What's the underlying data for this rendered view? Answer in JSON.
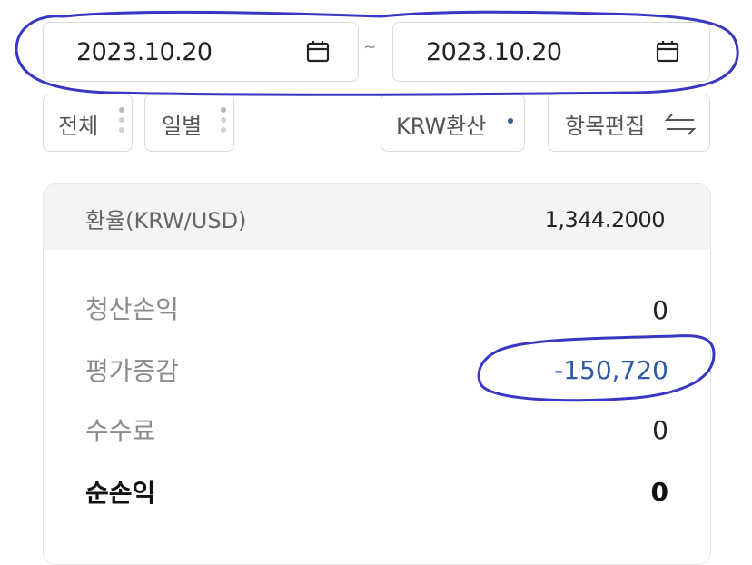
{
  "date_range": {
    "start": "2023.10.20",
    "separator": "~",
    "end": "2023.10.20"
  },
  "filters": {
    "all": "전체",
    "daily": "일별",
    "currency": "KRW환산",
    "edit_items": "항목편집"
  },
  "exchange_rate": {
    "label": "환율(KRW/USD)",
    "value": "1,344.2000"
  },
  "summary": {
    "rows": [
      {
        "label": "청산손익",
        "value": "0"
      },
      {
        "label": "평가증감",
        "value": "-150,720"
      },
      {
        "label": "수수료",
        "value": "0"
      },
      {
        "label": "순손익",
        "value": "0"
      }
    ]
  },
  "colors": {
    "negative": "#2b5aa8",
    "annotation": "#3a36c4",
    "dot_accent": "#2f5f8f"
  }
}
